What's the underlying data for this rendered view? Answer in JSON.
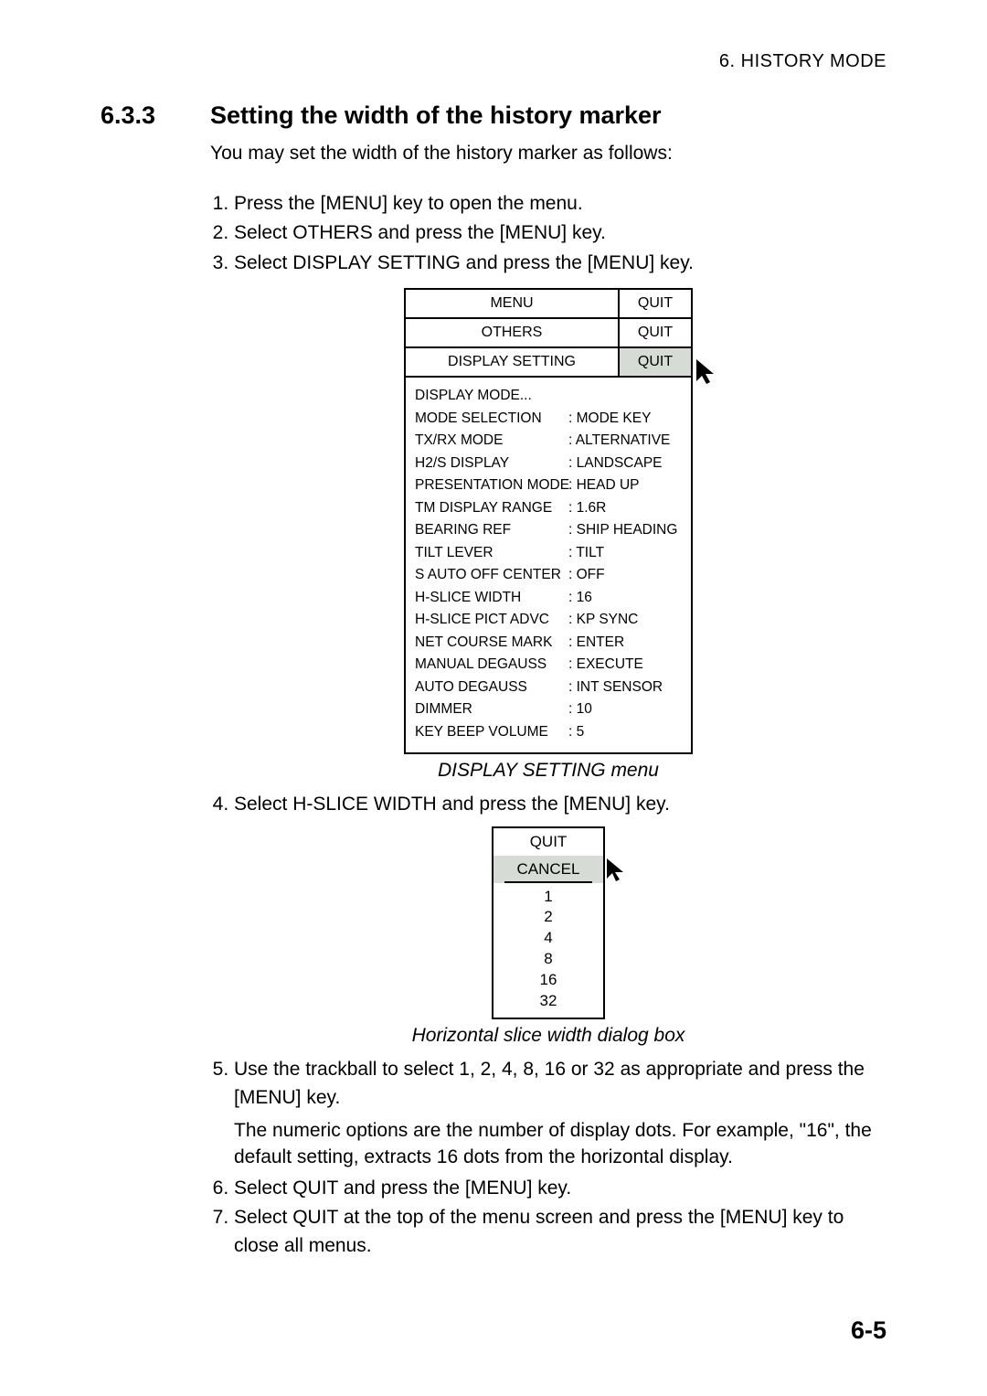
{
  "running_header": "6.  HISTORY  MODE",
  "section": {
    "number": "6.3.3",
    "title": "Setting the width of the history marker"
  },
  "intro": "You may set the width of the history marker as follows:",
  "steps": {
    "s1": "Press the [MENU] key to open the menu.",
    "s2": "Select OTHERS and press the [MENU] key.",
    "s3": "Select DISPLAY SETTING and press the [MENU] key.",
    "s4": "Select H-SLICE WIDTH and press the [MENU] key.",
    "s5": "Use the trackball to select 1, 2, 4, 8, 16 or 32 as appropriate and press the [MENU] key.",
    "s5b": "The numeric options are the number of display dots. For example, \"16\", the default setting, extracts 16 dots from the horizontal display.",
    "s6": "Select QUIT and press the [MENU] key.",
    "s7": "Select QUIT at the top of the menu screen and press the [MENU] key to close all menus."
  },
  "menu": {
    "rows": [
      {
        "left": "MENU",
        "right": "QUIT"
      },
      {
        "left": "OTHERS",
        "right": "QUIT"
      },
      {
        "left": "DISPLAY SETTING",
        "right": "QUIT"
      }
    ],
    "settings": [
      {
        "label": "DISPLAY MODE...",
        "value": ""
      },
      {
        "label": "MODE SELECTION",
        "value": ": MODE KEY"
      },
      {
        "label": "TX/RX MODE",
        "value": ": ALTERNATIVE"
      },
      {
        "label": "H2/S DISPLAY",
        "value": ": LANDSCAPE"
      },
      {
        "label": "PRESENTATION MODE",
        "value": ": HEAD UP"
      },
      {
        "label": "TM DISPLAY RANGE",
        "value": ": 1.6R"
      },
      {
        "label": "BEARING REF",
        "value": ": SHIP HEADING"
      },
      {
        "label": "TILT LEVER",
        "value": ": TILT"
      },
      {
        "label": "S AUTO OFF CENTER",
        "value": ": OFF"
      },
      {
        "label": "H-SLICE WIDTH",
        "value": ": 16"
      },
      {
        "label": "H-SLICE PICT ADVC",
        "value": ": KP SYNC"
      },
      {
        "label": "NET COURSE MARK",
        "value": ": ENTER"
      },
      {
        "label": "MANUAL DEGAUSS",
        "value": ": EXECUTE"
      },
      {
        "label": "AUTO DEGAUSS",
        "value": ": INT SENSOR"
      },
      {
        "label": "DIMMER",
        "value": ": 10"
      },
      {
        "label": "KEY BEEP VOLUME",
        "value": ": 5"
      }
    ]
  },
  "captions": {
    "menu": "DISPLAY SETTING menu",
    "dialog": "Horizontal slice width dialog box"
  },
  "dialog": {
    "quit": "QUIT",
    "cancel": "CANCEL",
    "options": [
      "1",
      "2",
      "4",
      "8",
      "16",
      "32"
    ]
  },
  "page_number": "6-5"
}
